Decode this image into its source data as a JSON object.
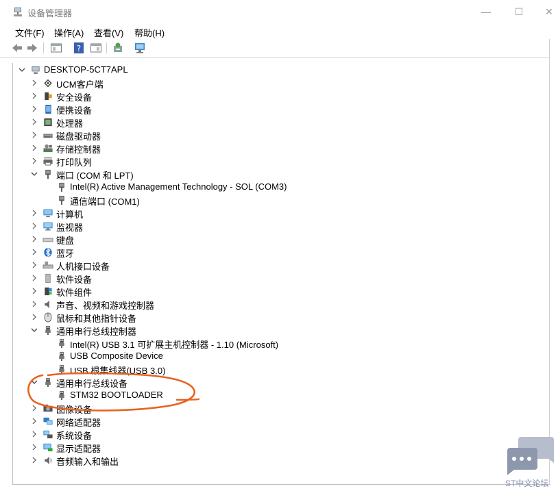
{
  "window": {
    "title": "设备管理器",
    "minimize_glyph": "—",
    "maximize_glyph": "☐",
    "close_glyph": "✕"
  },
  "menu": [
    "文件(F)",
    "操作(A)",
    "查看(V)",
    "帮助(H)"
  ],
  "toolbar": {
    "icons": [
      "back-arrow-icon",
      "forward-arrow-icon",
      "properties-pane-icon",
      "help-icon",
      "properties-icon",
      "update-driver-icon",
      "monitor-scan-icon"
    ]
  },
  "tree": {
    "root": "DESKTOP-5CT7APL",
    "categories": [
      {
        "label": "UCM客户端",
        "icon": "ucm-icon",
        "expanded": false
      },
      {
        "label": "安全设备",
        "icon": "security-device-icon",
        "expanded": false
      },
      {
        "label": "便携设备",
        "icon": "portable-device-icon",
        "expanded": false
      },
      {
        "label": "处理器",
        "icon": "processor-icon",
        "expanded": false
      },
      {
        "label": "磁盘驱动器",
        "icon": "disk-drive-icon",
        "expanded": false
      },
      {
        "label": "存储控制器",
        "icon": "storage-controller-icon",
        "expanded": false
      },
      {
        "label": "打印队列",
        "icon": "printer-icon",
        "expanded": false
      },
      {
        "label": "端口 (COM 和 LPT)",
        "icon": "port-icon",
        "expanded": true,
        "children": [
          "Intel(R) Active Management Technology - SOL (COM3)",
          "通信端口 (COM1)"
        ]
      },
      {
        "label": "计算机",
        "icon": "computer-icon",
        "expanded": false
      },
      {
        "label": "监视器",
        "icon": "monitor-icon",
        "expanded": false
      },
      {
        "label": "键盘",
        "icon": "keyboard-icon",
        "expanded": false
      },
      {
        "label": "蓝牙",
        "icon": "bluetooth-icon",
        "expanded": false
      },
      {
        "label": "人机接口设备",
        "icon": "hid-icon",
        "expanded": false
      },
      {
        "label": "软件设备",
        "icon": "software-device-icon",
        "expanded": false
      },
      {
        "label": "软件组件",
        "icon": "software-component-icon",
        "expanded": false
      },
      {
        "label": "声音、视频和游戏控制器",
        "icon": "sound-icon",
        "expanded": false
      },
      {
        "label": "鼠标和其他指针设备",
        "icon": "mouse-icon",
        "expanded": false
      },
      {
        "label": "通用串行总线控制器",
        "icon": "usb-icon",
        "expanded": true,
        "children": [
          "Intel(R) USB 3.1 可扩展主机控制器 - 1.10 (Microsoft)",
          "USB Composite Device",
          "USB 根集线器(USB 3.0)"
        ]
      },
      {
        "label": "通用串行总线设备",
        "icon": "usb-icon",
        "expanded": true,
        "children": [
          "STM32  BOOTLOADER"
        ]
      },
      {
        "label": "图像设备",
        "icon": "camera-icon",
        "expanded": false
      },
      {
        "label": "网络适配器",
        "icon": "network-adapter-icon",
        "expanded": false
      },
      {
        "label": "系统设备",
        "icon": "system-device-icon",
        "expanded": false
      },
      {
        "label": "显示适配器",
        "icon": "display-adapter-icon",
        "expanded": false
      },
      {
        "label": "音频输入和输出",
        "icon": "audio-io-icon",
        "expanded": false
      }
    ]
  },
  "annotation": {
    "color": "#e8621f"
  },
  "watermark": {
    "text": "ST中文论坛",
    "color": "#7d8aa6"
  }
}
